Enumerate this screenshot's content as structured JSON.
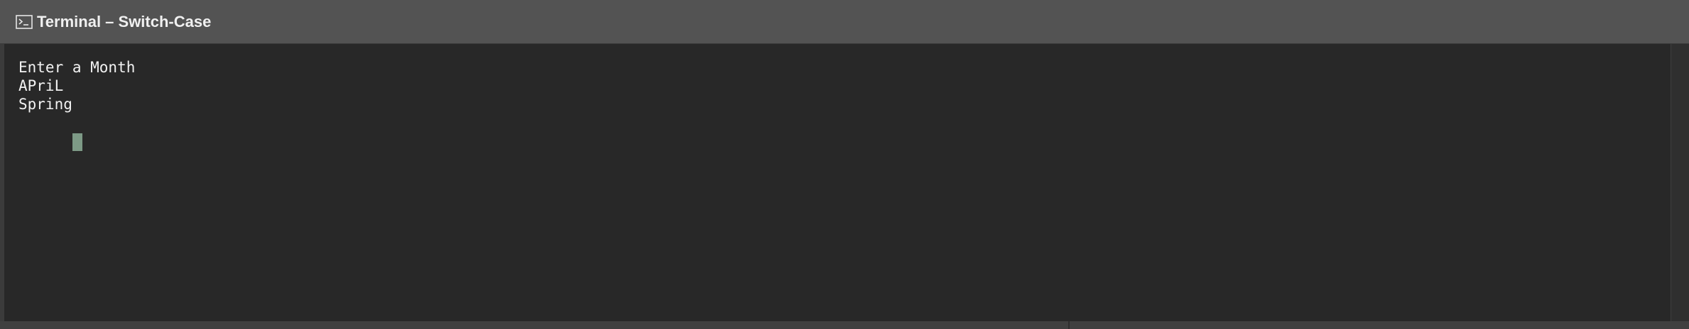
{
  "window": {
    "title": "Terminal – Switch-Case",
    "icon": "terminal-icon"
  },
  "terminal": {
    "lines": [
      "Enter a Month",
      "APriL",
      "Spring"
    ],
    "cursor_color": "#7d9a86"
  },
  "colors": {
    "titlebar": "#535353",
    "background": "#282828",
    "text": "#f2f2f2"
  }
}
